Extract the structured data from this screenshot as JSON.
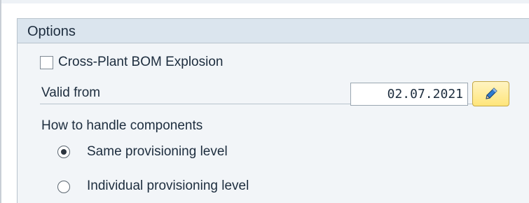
{
  "options_group": {
    "title": "Options",
    "cross_plant_checkbox": {
      "label": "Cross-Plant BOM Explosion",
      "checked": false
    },
    "valid_from": {
      "label": "Valid from",
      "value": "02.07.2021",
      "edit_icon": "pencil-icon"
    },
    "components": {
      "label": "How to handle components",
      "options": [
        {
          "label": "Same provisioning level",
          "selected": true
        },
        {
          "label": "Individual provisioning level",
          "selected": false
        }
      ]
    }
  },
  "colors": {
    "group_header": "#dbe5ee",
    "group_background": "#f2f5f8",
    "edit_button": "#ffe57a",
    "pencil_icon": "#1b5fa8"
  }
}
